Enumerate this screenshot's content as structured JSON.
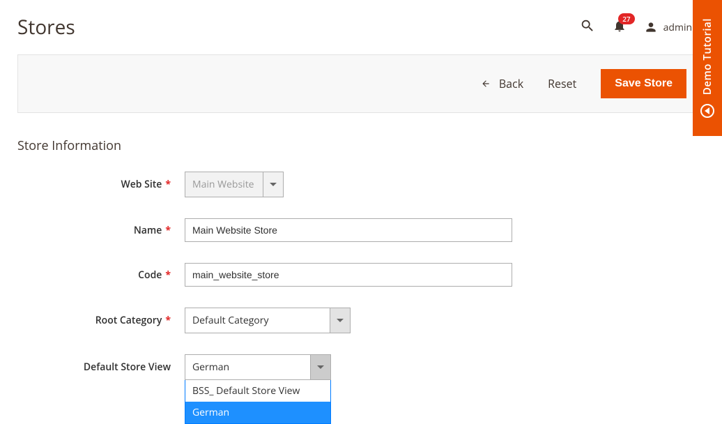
{
  "header": {
    "title": "Stores",
    "notification_count": "27",
    "user_name": "admin"
  },
  "toolbar": {
    "back_label": "Back",
    "reset_label": "Reset",
    "save_label": "Save Store"
  },
  "section": {
    "title": "Store Information"
  },
  "form": {
    "website": {
      "label": "Web Site",
      "value": "Main Website"
    },
    "name": {
      "label": "Name",
      "value": "Main Website Store"
    },
    "code": {
      "label": "Code",
      "value": "main_website_store"
    },
    "root_category": {
      "label": "Root Category",
      "value": "Default Category"
    },
    "default_store_view": {
      "label": "Default Store View",
      "value": "German",
      "options": [
        "BSS_ Default Store View",
        "German"
      ]
    }
  },
  "demo_tab": {
    "label": "Demo Tutorial"
  }
}
